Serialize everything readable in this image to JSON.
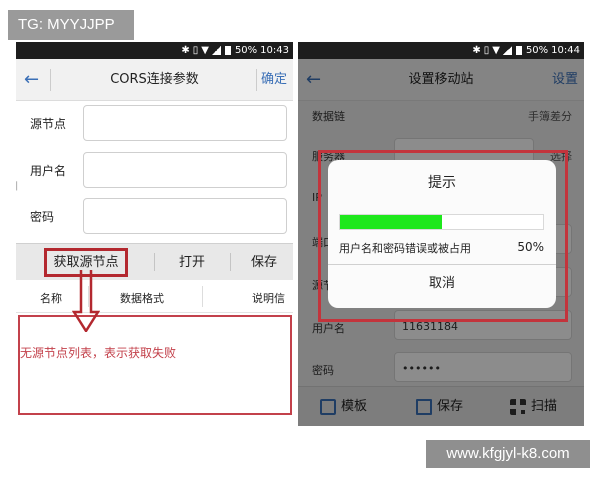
{
  "watermark_top": "TG: MYYJJPP",
  "watermark_bottom": "www.kfgjyl-k8.com",
  "left_phone": {
    "status": {
      "battery": "50%",
      "time": "10:43"
    },
    "title": "CORS连接参数",
    "confirm": "确定",
    "fields": [
      {
        "label": "源节点",
        "value": ""
      },
      {
        "label": "用户名",
        "value": ""
      },
      {
        "label": "密码",
        "value": ""
      }
    ],
    "toolbar": {
      "fetch": "获取源节点",
      "open": "打开",
      "save": "保存"
    },
    "table_headers": [
      "名称",
      "数据格式",
      "说明信"
    ],
    "annotation": "无源节点列表，表示获取失败"
  },
  "right_phone": {
    "status": {
      "battery": "50%",
      "time": "10:44"
    },
    "title": "设置移动站",
    "settings": "设置",
    "rows": [
      {
        "label": "数据链",
        "value": "手簿差分"
      },
      {
        "label": "服务器",
        "value": ""
      },
      {
        "label": "IP",
        "value": ""
      },
      {
        "label": "端口",
        "value": ""
      },
      {
        "label": "源节点",
        "value": ""
      },
      {
        "label": "用户名",
        "value": "11631184"
      },
      {
        "label": "密码",
        "value": "••••••"
      }
    ],
    "select_label": "选择",
    "bottom": {
      "template": "模板",
      "save": "保存",
      "scan": "扫描"
    },
    "dialog": {
      "title": "提示",
      "message": "用户名和密码错误或被占用",
      "percent": "50%",
      "progress": 0.5,
      "cancel": "取消"
    }
  },
  "colors": {
    "accent": "#3a6fb6",
    "highlight_red": "#c3414b",
    "progress_green": "#1ee81c"
  }
}
